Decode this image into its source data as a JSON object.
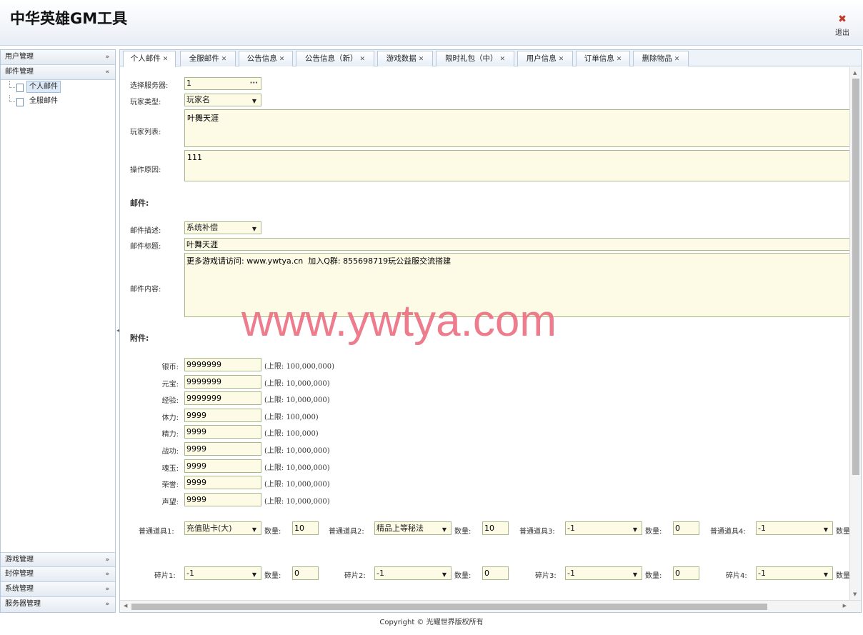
{
  "header": {
    "title": "中华英雄GM工具",
    "logout_label": "退出"
  },
  "sidebar": {
    "groups_top": [
      {
        "label": "用户管理",
        "chevron": "»"
      },
      {
        "label": "邮件管理",
        "chevron": "«"
      }
    ],
    "mail_items": [
      {
        "label": "个人邮件",
        "selected": true
      },
      {
        "label": "全服邮件",
        "selected": false
      }
    ],
    "groups_bottom": [
      {
        "label": "游戏管理",
        "chevron": "»"
      },
      {
        "label": "封停管理",
        "chevron": "»"
      },
      {
        "label": "系统管理",
        "chevron": "»"
      },
      {
        "label": "服务器管理",
        "chevron": "»"
      }
    ]
  },
  "tabs": [
    {
      "label": "个人邮件",
      "active": true
    },
    {
      "label": "全服邮件",
      "active": false
    },
    {
      "label": "公告信息",
      "active": false
    },
    {
      "label": "公告信息（新）",
      "active": false
    },
    {
      "label": "游戏数据",
      "active": false
    },
    {
      "label": "限时礼包（中）",
      "active": false
    },
    {
      "label": "用户信息",
      "active": false
    },
    {
      "label": "订单信息",
      "active": false
    },
    {
      "label": "删除物品",
      "active": false
    }
  ],
  "form": {
    "server_label": "选择服务器:",
    "server_value": "1",
    "player_type_label": "玩家类型:",
    "player_type_value": "玩家名",
    "player_list_label": "玩家列表:",
    "player_list_value": "叶舞天涯",
    "reason_label": "操作原因:",
    "reason_value": "111",
    "mail_section": "邮件:",
    "mail_desc_label": "邮件描述:",
    "mail_desc_value": "系统补偿",
    "mail_title_label": "邮件标题:",
    "mail_title_value": "叶舞天涯",
    "mail_content_label": "邮件内容:",
    "mail_content_value": "更多游戏请访问: www.ywtya.cn  加入Q群: 855698719玩公益服交流搭建",
    "attach_section": "附件:",
    "resources": [
      {
        "label": "银币:",
        "value": "9999999",
        "hint": "(上限: 100,000,000)"
      },
      {
        "label": "元宝:",
        "value": "9999999",
        "hint": "(上限: 10,000,000)"
      },
      {
        "label": "经验:",
        "value": "9999999",
        "hint": "(上限: 10,000,000)"
      },
      {
        "label": "体力:",
        "value": "9999",
        "hint": "(上限: 100,000)"
      },
      {
        "label": "精力:",
        "value": "9999",
        "hint": "(上限: 100,000)"
      },
      {
        "label": "战功:",
        "value": "9999",
        "hint": "(上限: 10,000,000)"
      },
      {
        "label": "魂玉:",
        "value": "9999",
        "hint": "(上限: 10,000,000)"
      },
      {
        "label": "荣誉:",
        "value": "9999",
        "hint": "(上限: 10,000,000)"
      },
      {
        "label": "声望:",
        "value": "9999",
        "hint": "(上限: 10,000,000)"
      }
    ],
    "items": [
      {
        "label": "普通道具1:",
        "value": "充值贴卡(大)",
        "qty_label": "数量:",
        "qty": "10"
      },
      {
        "label": "普通道具2:",
        "value": "精品上等秘法",
        "qty_label": "数量:",
        "qty": "10"
      },
      {
        "label": "普通道具3:",
        "value": "-1",
        "qty_label": "数量:",
        "qty": "0"
      },
      {
        "label": "普通道具4:",
        "value": "-1",
        "qty_label": "数量:",
        "qty": ""
      }
    ],
    "fragments": [
      {
        "label": "碎片1:",
        "value": "-1",
        "qty_label": "数量:",
        "qty": "0"
      },
      {
        "label": "碎片2:",
        "value": "-1",
        "qty_label": "数量:",
        "qty": "0"
      },
      {
        "label": "碎片3:",
        "value": "-1",
        "qty_label": "数量:",
        "qty": "0"
      },
      {
        "label": "碎片4:",
        "value": "-1",
        "qty_label": "数量:",
        "qty": ""
      }
    ]
  },
  "watermark": "www.ywtya.com",
  "footer": "Copyright © 光耀世界版权所有"
}
